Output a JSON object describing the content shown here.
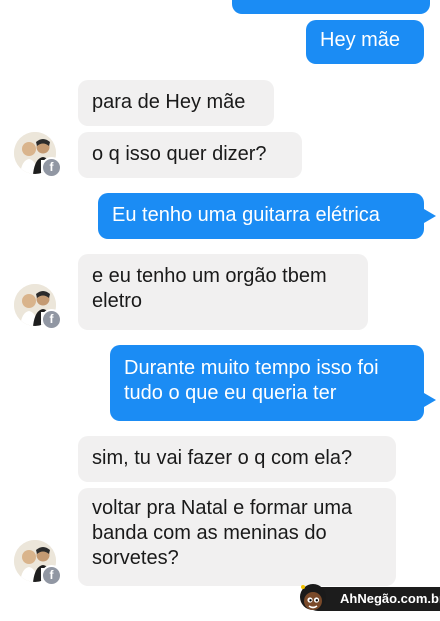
{
  "conversation": {
    "messages": [
      {
        "from": "me",
        "text": "Hey mãe"
      },
      {
        "from": "them",
        "text": "para de Hey mãe"
      },
      {
        "from": "them",
        "text": "o q isso quer dizer?"
      },
      {
        "from": "me",
        "text": "Eu tenho uma guitarra elétrica"
      },
      {
        "from": "them",
        "lines": [
          "e eu tenho um orgão tbem",
          "eletro"
        ]
      },
      {
        "from": "me",
        "lines": [
          "Durante muito tempo isso foi",
          "tudo o que eu queria ter"
        ]
      },
      {
        "from": "them",
        "text": "sim, tu vai fazer o q com ela?"
      },
      {
        "from": "them",
        "lines": [
          "voltar pra Natal e formar uma",
          "banda com as meninas do",
          "sorvetes?"
        ]
      }
    ]
  },
  "colors": {
    "outgoing_bubble": "#1b8cf4",
    "incoming_bubble": "#f1f0f0",
    "badge": "#9197a3"
  },
  "icons": {
    "avatar": "contact-avatar",
    "badge": "facebook-badge-icon"
  },
  "watermark": {
    "text": "AhNegão.com.br"
  }
}
